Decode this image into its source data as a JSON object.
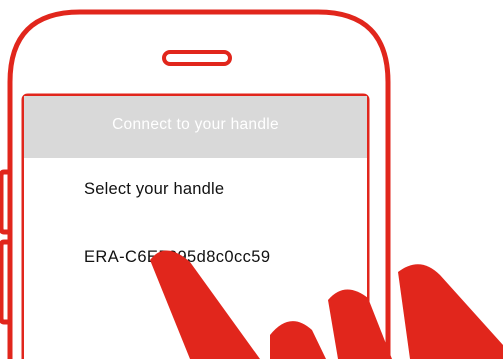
{
  "colors": {
    "accent": "#e1261c",
    "header_bg": "#d9d9d9",
    "header_text": "#ffffff",
    "text": "#111111",
    "background": "#ffffff"
  },
  "header": {
    "title": "Connect to your handle"
  },
  "main": {
    "section_title": "Select your handle",
    "devices": [
      {
        "label": "ERA-C6E5295d8c0cc59"
      }
    ]
  },
  "icons": {
    "phone": "phone-outline-icon",
    "speaker": "speaker-slot-icon",
    "hand": "tapping-hand-icon"
  }
}
